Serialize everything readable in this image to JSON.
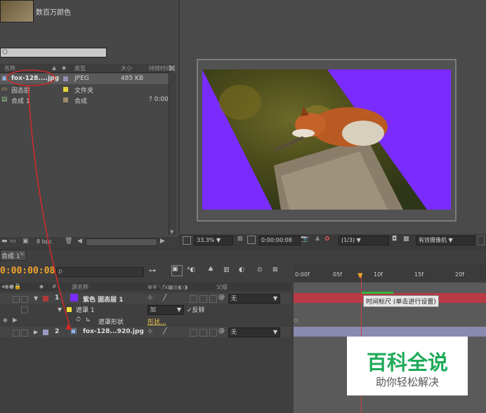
{
  "project": {
    "thumb_info": "数百万颜色",
    "columns": {
      "name": "名称",
      "type": "类型",
      "size": "大小",
      "duration": "持续时间"
    },
    "items": [
      {
        "name": "fox-128....jpg",
        "type": "JPEG",
        "size": "485 KB",
        "duration": "",
        "swatch": "#8f8fb8"
      },
      {
        "name": "固态层",
        "type": "文件夹",
        "size": "",
        "duration": "",
        "swatch": "#e3d23a"
      },
      {
        "name": "合成 1",
        "type": "合成",
        "size": "",
        "duration": "? 0:00",
        "swatch": "#a08a6a"
      }
    ],
    "bpc": "8 bpc"
  },
  "viewer": {
    "zoom": "33.3%",
    "timecode": "0:00:00:08",
    "resolution": "(1/3)",
    "camera": "有效摄像机"
  },
  "timeline": {
    "tab_label": "合成 1",
    "timecode": "0:00:00:08",
    "col_source": "源名称",
    "col_parent": "父级",
    "col_num": "#",
    "ruler": [
      "0:00f",
      "05f",
      "10f",
      "15f",
      "20f"
    ],
    "layers": [
      {
        "num": "1",
        "name": "紫色 固态层 1",
        "parent": "无",
        "color": "#b13a3a",
        "swatch": "#7a2cff"
      },
      {
        "num": "",
        "name": "遮罩 1",
        "mode": "加",
        "invert": "反转",
        "swatch": "#f2e03a"
      },
      {
        "num": "",
        "name": "遮罩形状",
        "shape_link": "形状..."
      },
      {
        "num": "2",
        "name": "fox-128...920.jpg",
        "parent": "无",
        "color": "#9a9ac0"
      }
    ],
    "tooltip": "时间标尺 (单击进行设置)"
  },
  "watermark": {
    "title": "百科全说",
    "subtitle": "助你轻松解决",
    "title_color": "#1faa5a"
  }
}
